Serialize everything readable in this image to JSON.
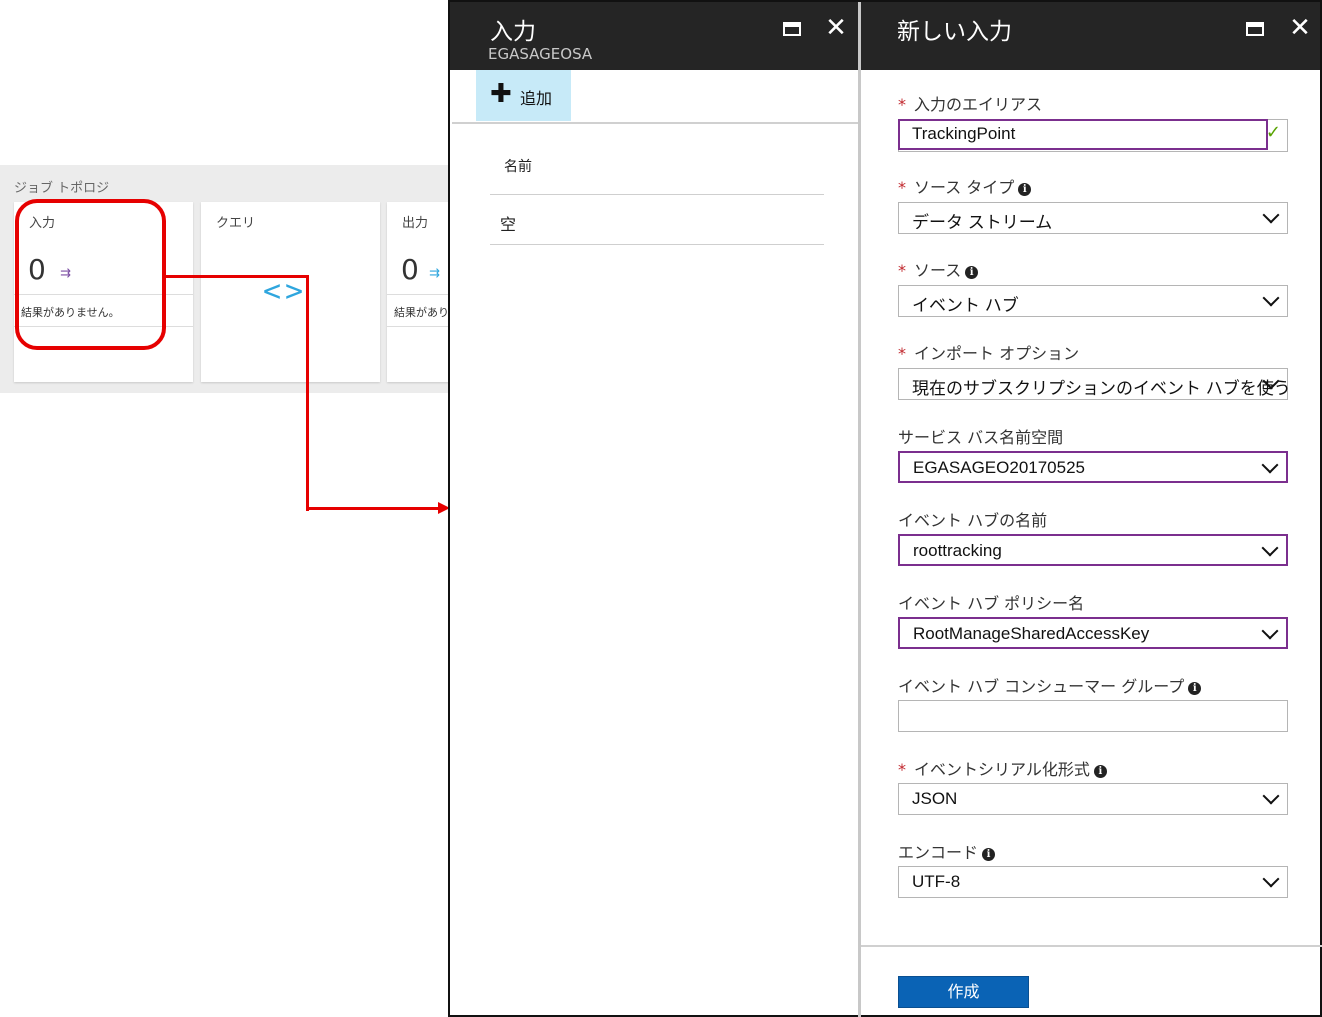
{
  "topology": {
    "title": "ジョブ トポロジ",
    "tiles": [
      {
        "title": "入力",
        "count": "0",
        "status": "結果がありません。"
      },
      {
        "title": "クエリ",
        "symbol": "<>"
      },
      {
        "title": "出力",
        "count": "0",
        "status": "結果がありま"
      }
    ]
  },
  "inputs_blade": {
    "title": "入力",
    "subtitle": "EGASAGEOSA",
    "add_label": "追加",
    "column_name": "名前",
    "empty_text": "空"
  },
  "new_input_blade": {
    "title": "新しい入力",
    "fields": {
      "alias": {
        "label": "入力のエイリアス",
        "value": "TrackingPoint"
      },
      "source_type": {
        "label": "ソース タイプ",
        "value": "データ ストリーム"
      },
      "source": {
        "label": "ソース",
        "value": "イベント ハブ"
      },
      "import_option": {
        "label": "インポート オプション",
        "value": "現在のサブスクリプションのイベント ハブを使う"
      },
      "namespace": {
        "label": "サービス バス名前空間",
        "value": "EGASAGEO20170525"
      },
      "event_hub_name": {
        "label": "イベント ハブの名前",
        "value": "roottracking"
      },
      "policy_name": {
        "label": "イベント ハブ ポリシー名",
        "value": "RootManageSharedAccessKey"
      },
      "consumer_group": {
        "label": "イベント ハブ コンシューマー グループ",
        "value": ""
      },
      "serialization": {
        "label": "イベントシリアル化形式",
        "value": "JSON"
      },
      "encoding": {
        "label": "エンコード",
        "value": "UTF-8"
      }
    },
    "create_label": "作成"
  },
  "icons": {
    "input": "input-arrow-icon",
    "output": "output-arrow-icon",
    "add": "plus-icon",
    "maximize": "maximize-icon",
    "close": "close-icon",
    "info": "info-icon",
    "check": "check-icon",
    "dropdown": "chevron-down-icon"
  },
  "colors": {
    "header_bg": "#252525",
    "accent_purple": "#7b2f8e",
    "primary_button": "#0a63b5",
    "add_button_bg": "#c7eaf8",
    "annotation_red": "#e60000",
    "required_star": "#c1272d"
  }
}
